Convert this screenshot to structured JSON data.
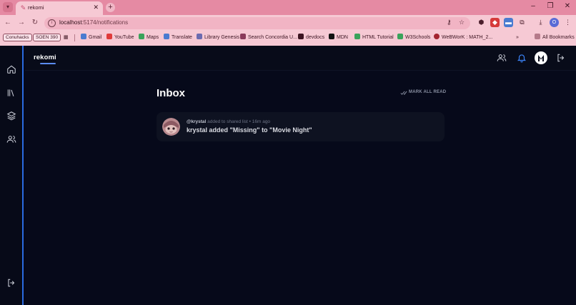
{
  "browser": {
    "tab": {
      "title": "rekomi",
      "close": "✕"
    },
    "new_tab": "+",
    "window_controls": {
      "minimize": "–",
      "maximize": "❐",
      "close": "✕"
    },
    "nav": {
      "back": "←",
      "forward": "→",
      "reload": "↻"
    },
    "url_host": "localhost",
    "url_path": ":5174/notifications",
    "profile_initial": "O",
    "bookmarks": {
      "pills": [
        "Conuhacks",
        "SOEN 390"
      ],
      "items": [
        "Gmail",
        "YouTube",
        "Maps",
        "Translate",
        "Library Genesis",
        "Search Concordia U...",
        "devdocs",
        "MDN",
        "HTML Tutorial",
        "W3Schools",
        "WeBWorK : MATH_2..."
      ],
      "overflow": "»",
      "all_bookmarks": "All Bookmarks"
    },
    "colors": {
      "chrome": "#f6c9d4",
      "tabstrip": "#e58aa3"
    }
  },
  "app": {
    "logo": "rekomi",
    "sidebar_icons": [
      "home-icon",
      "library-icon",
      "layers-icon",
      "users-icon",
      "logout-icon"
    ],
    "header_icons": [
      "friends-icon",
      "bell-icon",
      "profile-avatar",
      "logout-icon"
    ],
    "colors": {
      "background": "#06091a",
      "accent": "#2a6be0",
      "bell": "#3b82f6"
    }
  },
  "inbox": {
    "title": "Inbox",
    "mark_all_read": "MARK ALL READ",
    "notifications": [
      {
        "user": "@krystal",
        "action": "added to shared list",
        "time": "• 16m ago",
        "message": "krystal added \"Missing\" to \"Movie Night\""
      }
    ]
  }
}
